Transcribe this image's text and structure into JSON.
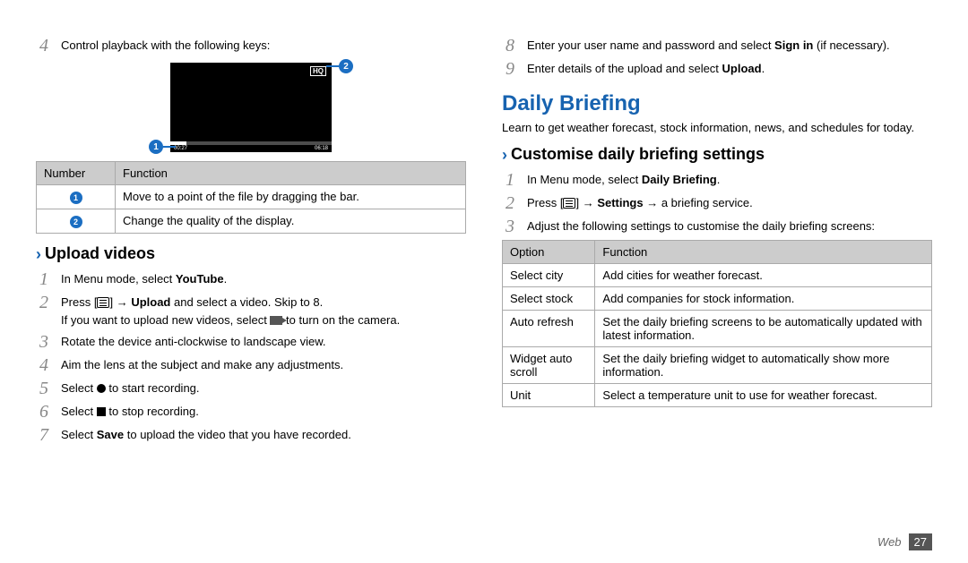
{
  "left": {
    "step4": "Control playback with the following keys:",
    "video": {
      "timeL": "00:27",
      "timeR": "06:18",
      "c1": "1",
      "c2": "2"
    },
    "table1": {
      "h1": "Number",
      "h2": "Function",
      "r1_num": "1",
      "r1_fn": "Move to a point of the file by dragging the bar.",
      "r2_num": "2",
      "r2_fn": "Change the quality of the display."
    },
    "upload_heading": "Upload videos",
    "u1a": "In Menu mode, select ",
    "u1b": "YouTube",
    "u1c": ".",
    "u2a": "Press [",
    "u2b": "] → ",
    "u2c": "Upload",
    "u2d": " and select a video. Skip to 8.",
    "u2sub_a": "If you want to upload new videos, select ",
    "u2sub_b": " to turn on the camera.",
    "u3": "Rotate the device anti-clockwise to landscape view.",
    "u4": "Aim the lens at the subject and make any adjustments.",
    "u5a": "Select ",
    "u5b": " to start recording.",
    "u6a": "Select ",
    "u6b": " to stop recording.",
    "u7a": "Select ",
    "u7b": "Save",
    "u7c": " to upload the video that you have recorded."
  },
  "right": {
    "s8a": "Enter your user name and password and select ",
    "s8b": "Sign in",
    "s8c": " (if necessary).",
    "s9a": "Enter details of the upload and select ",
    "s9b": "Upload",
    "s9c": ".",
    "db_heading": "Daily Briefing",
    "db_intro": "Learn to get weather forecast, stock information, news, and schedules for today.",
    "cdb_heading": "Customise daily briefing settings",
    "c1a": "In Menu mode, select ",
    "c1b": "Daily Briefing",
    "c1c": ".",
    "c2a": "Press [",
    "c2b": "] → ",
    "c2c": "Settings",
    "c2d": " → a briefing service.",
    "c3": "Adjust the following settings to customise the daily briefing screens:",
    "table2": {
      "h1": "Option",
      "h2": "Function",
      "r1o": "Select city",
      "r1f": "Add cities for weather forecast.",
      "r2o": "Select stock",
      "r2f": "Add companies for stock information.",
      "r3o": "Auto refresh",
      "r3f": "Set the daily briefing screens to be automatically updated with latest information.",
      "r4o": "Widget auto scroll",
      "r4f": "Set the daily briefing widget to automatically show more information.",
      "r5o": "Unit",
      "r5f": "Select a temperature unit to use for weather forecast."
    }
  },
  "footer": {
    "cat": "Web",
    "page": "27"
  },
  "nums": {
    "n1": "1",
    "n2": "2",
    "n3": "3",
    "n4": "4",
    "n5": "5",
    "n6": "6",
    "n7": "7",
    "n8": "8",
    "n9": "9"
  }
}
